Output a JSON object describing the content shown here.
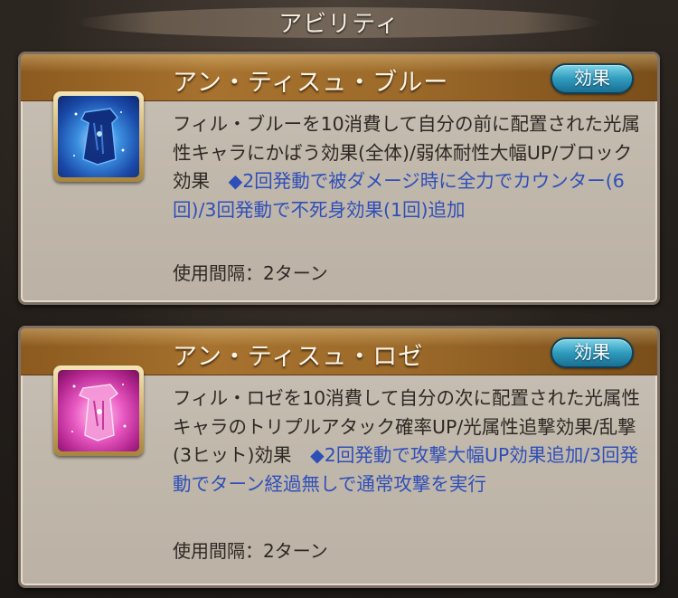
{
  "header": {
    "title": "アビリティ"
  },
  "abilities": [
    {
      "name": "アン・ティスュ・ブルー",
      "effect_button": "効果",
      "icon": "blue-fabric-icon",
      "description": "フィル・ブルーを10消費して自分の前に配置された光属性キャラにかばう効果(全体)/弱体耐性大幅UP/ブロック効果",
      "bonus": "◆2回発動で被ダメージ時に全力でカウンター(6回)/3回発動で不死身効果(1回)追加",
      "interval": "使用間隔：2ターン"
    },
    {
      "name": "アン・ティスュ・ロゼ",
      "effect_button": "効果",
      "icon": "pink-fabric-icon",
      "description": "フィル・ロゼを10消費して自分の次に配置された光属性キャラのトリプルアタック確率UP/光属性追撃効果/乱撃(3ヒット)効果",
      "bonus": "◆2回発動で攻撃大幅UP効果追加/3回発動でターン経過無しで通常攻撃を実行",
      "interval": "使用間隔：2ターン"
    }
  ],
  "colors": {
    "highlight_text": "#2f4fb8",
    "body_text": "#2d2823",
    "header_bar": "#a7722e",
    "effect_button": "#2f9bbd"
  }
}
